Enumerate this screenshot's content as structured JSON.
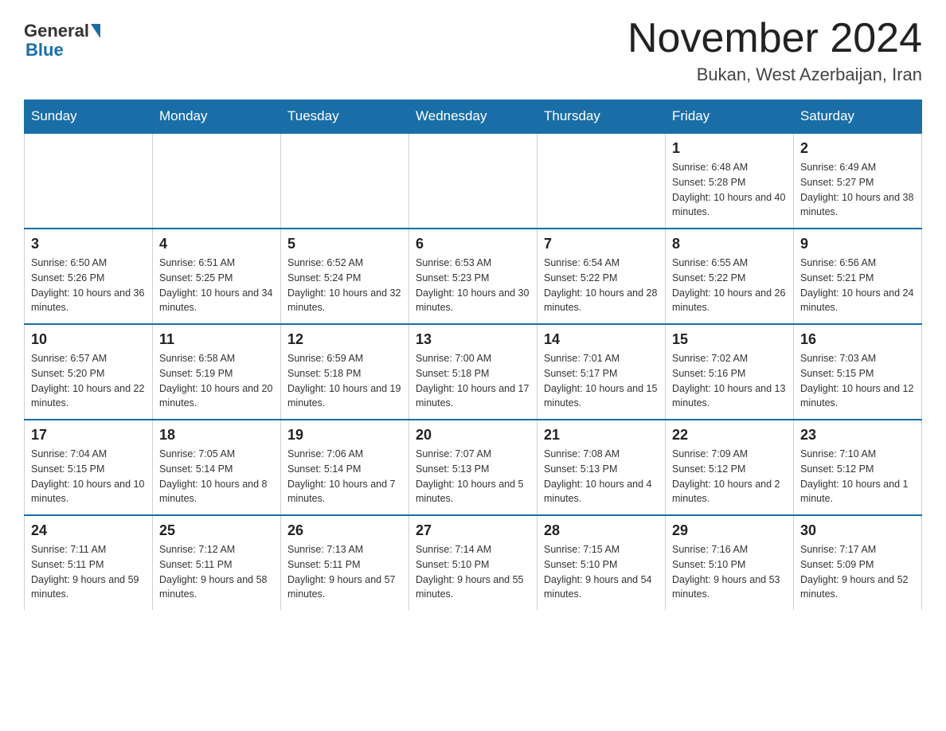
{
  "logo": {
    "general": "General",
    "blue": "Blue"
  },
  "title": "November 2024",
  "location": "Bukan, West Azerbaijan, Iran",
  "days_of_week": [
    "Sunday",
    "Monday",
    "Tuesday",
    "Wednesday",
    "Thursday",
    "Friday",
    "Saturday"
  ],
  "weeks": [
    [
      {
        "day": "",
        "sunrise": "",
        "sunset": "",
        "daylight": ""
      },
      {
        "day": "",
        "sunrise": "",
        "sunset": "",
        "daylight": ""
      },
      {
        "day": "",
        "sunrise": "",
        "sunset": "",
        "daylight": ""
      },
      {
        "day": "",
        "sunrise": "",
        "sunset": "",
        "daylight": ""
      },
      {
        "day": "",
        "sunrise": "",
        "sunset": "",
        "daylight": ""
      },
      {
        "day": "1",
        "sunrise": "Sunrise: 6:48 AM",
        "sunset": "Sunset: 5:28 PM",
        "daylight": "Daylight: 10 hours and 40 minutes."
      },
      {
        "day": "2",
        "sunrise": "Sunrise: 6:49 AM",
        "sunset": "Sunset: 5:27 PM",
        "daylight": "Daylight: 10 hours and 38 minutes."
      }
    ],
    [
      {
        "day": "3",
        "sunrise": "Sunrise: 6:50 AM",
        "sunset": "Sunset: 5:26 PM",
        "daylight": "Daylight: 10 hours and 36 minutes."
      },
      {
        "day": "4",
        "sunrise": "Sunrise: 6:51 AM",
        "sunset": "Sunset: 5:25 PM",
        "daylight": "Daylight: 10 hours and 34 minutes."
      },
      {
        "day": "5",
        "sunrise": "Sunrise: 6:52 AM",
        "sunset": "Sunset: 5:24 PM",
        "daylight": "Daylight: 10 hours and 32 minutes."
      },
      {
        "day": "6",
        "sunrise": "Sunrise: 6:53 AM",
        "sunset": "Sunset: 5:23 PM",
        "daylight": "Daylight: 10 hours and 30 minutes."
      },
      {
        "day": "7",
        "sunrise": "Sunrise: 6:54 AM",
        "sunset": "Sunset: 5:22 PM",
        "daylight": "Daylight: 10 hours and 28 minutes."
      },
      {
        "day": "8",
        "sunrise": "Sunrise: 6:55 AM",
        "sunset": "Sunset: 5:22 PM",
        "daylight": "Daylight: 10 hours and 26 minutes."
      },
      {
        "day": "9",
        "sunrise": "Sunrise: 6:56 AM",
        "sunset": "Sunset: 5:21 PM",
        "daylight": "Daylight: 10 hours and 24 minutes."
      }
    ],
    [
      {
        "day": "10",
        "sunrise": "Sunrise: 6:57 AM",
        "sunset": "Sunset: 5:20 PM",
        "daylight": "Daylight: 10 hours and 22 minutes."
      },
      {
        "day": "11",
        "sunrise": "Sunrise: 6:58 AM",
        "sunset": "Sunset: 5:19 PM",
        "daylight": "Daylight: 10 hours and 20 minutes."
      },
      {
        "day": "12",
        "sunrise": "Sunrise: 6:59 AM",
        "sunset": "Sunset: 5:18 PM",
        "daylight": "Daylight: 10 hours and 19 minutes."
      },
      {
        "day": "13",
        "sunrise": "Sunrise: 7:00 AM",
        "sunset": "Sunset: 5:18 PM",
        "daylight": "Daylight: 10 hours and 17 minutes."
      },
      {
        "day": "14",
        "sunrise": "Sunrise: 7:01 AM",
        "sunset": "Sunset: 5:17 PM",
        "daylight": "Daylight: 10 hours and 15 minutes."
      },
      {
        "day": "15",
        "sunrise": "Sunrise: 7:02 AM",
        "sunset": "Sunset: 5:16 PM",
        "daylight": "Daylight: 10 hours and 13 minutes."
      },
      {
        "day": "16",
        "sunrise": "Sunrise: 7:03 AM",
        "sunset": "Sunset: 5:15 PM",
        "daylight": "Daylight: 10 hours and 12 minutes."
      }
    ],
    [
      {
        "day": "17",
        "sunrise": "Sunrise: 7:04 AM",
        "sunset": "Sunset: 5:15 PM",
        "daylight": "Daylight: 10 hours and 10 minutes."
      },
      {
        "day": "18",
        "sunrise": "Sunrise: 7:05 AM",
        "sunset": "Sunset: 5:14 PM",
        "daylight": "Daylight: 10 hours and 8 minutes."
      },
      {
        "day": "19",
        "sunrise": "Sunrise: 7:06 AM",
        "sunset": "Sunset: 5:14 PM",
        "daylight": "Daylight: 10 hours and 7 minutes."
      },
      {
        "day": "20",
        "sunrise": "Sunrise: 7:07 AM",
        "sunset": "Sunset: 5:13 PM",
        "daylight": "Daylight: 10 hours and 5 minutes."
      },
      {
        "day": "21",
        "sunrise": "Sunrise: 7:08 AM",
        "sunset": "Sunset: 5:13 PM",
        "daylight": "Daylight: 10 hours and 4 minutes."
      },
      {
        "day": "22",
        "sunrise": "Sunrise: 7:09 AM",
        "sunset": "Sunset: 5:12 PM",
        "daylight": "Daylight: 10 hours and 2 minutes."
      },
      {
        "day": "23",
        "sunrise": "Sunrise: 7:10 AM",
        "sunset": "Sunset: 5:12 PM",
        "daylight": "Daylight: 10 hours and 1 minute."
      }
    ],
    [
      {
        "day": "24",
        "sunrise": "Sunrise: 7:11 AM",
        "sunset": "Sunset: 5:11 PM",
        "daylight": "Daylight: 9 hours and 59 minutes."
      },
      {
        "day": "25",
        "sunrise": "Sunrise: 7:12 AM",
        "sunset": "Sunset: 5:11 PM",
        "daylight": "Daylight: 9 hours and 58 minutes."
      },
      {
        "day": "26",
        "sunrise": "Sunrise: 7:13 AM",
        "sunset": "Sunset: 5:11 PM",
        "daylight": "Daylight: 9 hours and 57 minutes."
      },
      {
        "day": "27",
        "sunrise": "Sunrise: 7:14 AM",
        "sunset": "Sunset: 5:10 PM",
        "daylight": "Daylight: 9 hours and 55 minutes."
      },
      {
        "day": "28",
        "sunrise": "Sunrise: 7:15 AM",
        "sunset": "Sunset: 5:10 PM",
        "daylight": "Daylight: 9 hours and 54 minutes."
      },
      {
        "day": "29",
        "sunrise": "Sunrise: 7:16 AM",
        "sunset": "Sunset: 5:10 PM",
        "daylight": "Daylight: 9 hours and 53 minutes."
      },
      {
        "day": "30",
        "sunrise": "Sunrise: 7:17 AM",
        "sunset": "Sunset: 5:09 PM",
        "daylight": "Daylight: 9 hours and 52 minutes."
      }
    ]
  ]
}
